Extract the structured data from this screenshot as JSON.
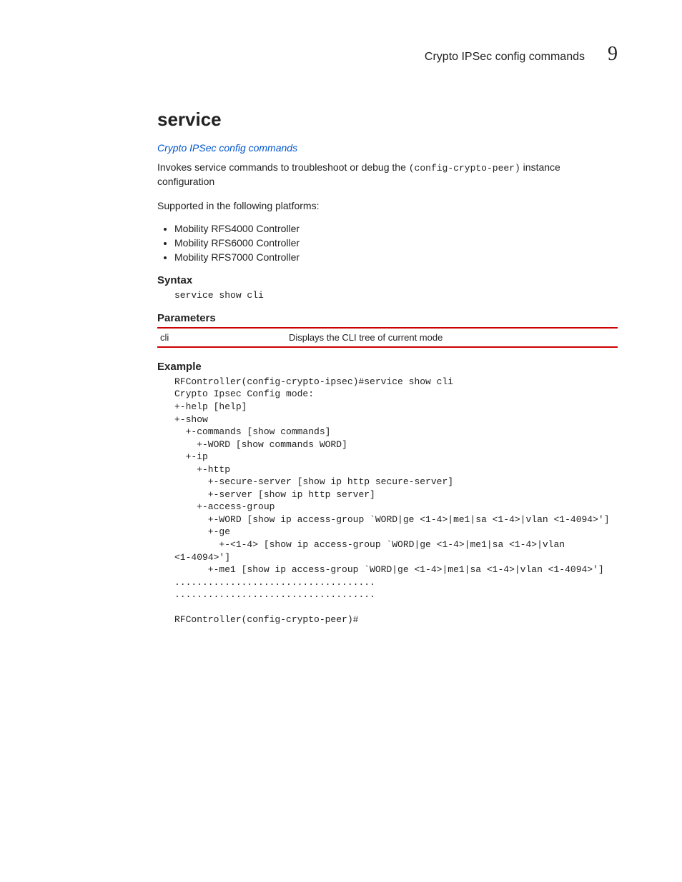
{
  "header": {
    "section_title": "Crypto IPSec config commands",
    "chapter_number": "9"
  },
  "title": "service",
  "link_text": "Crypto IPSec config commands",
  "intro": {
    "pre": "Invokes service commands to troubleshoot or debug the ",
    "code": "(config-crypto-peer)",
    "post": " instance configuration"
  },
  "supported_intro": "Supported in the following platforms:",
  "platforms": [
    "Mobility RFS4000 Controller",
    "Mobility RFS6000 Controller",
    "Mobility RFS7000 Controller"
  ],
  "syntax": {
    "heading": "Syntax",
    "code": "service show cli"
  },
  "parameters": {
    "heading": "Parameters",
    "rows": [
      {
        "key": "cli",
        "desc": "Displays the CLI tree of current mode"
      }
    ]
  },
  "example": {
    "heading": "Example",
    "code": "RFController(config-crypto-ipsec)#service show cli\nCrypto Ipsec Config mode:\n+-help [help]\n+-show\n  +-commands [show commands]\n    +-WORD [show commands WORD]\n  +-ip\n    +-http\n      +-secure-server [show ip http secure-server]\n      +-server [show ip http server]\n    +-access-group\n      +-WORD [show ip access-group `WORD|ge <1-4>|me1|sa <1-4>|vlan <1-4094>']\n      +-ge\n        +-<1-4> [show ip access-group `WORD|ge <1-4>|me1|sa <1-4>|vlan \n<1-4094>']\n      +-me1 [show ip access-group `WORD|ge <1-4>|me1|sa <1-4>|vlan <1-4094>']\n....................................\n....................................\n\nRFController(config-crypto-peer)#"
  }
}
